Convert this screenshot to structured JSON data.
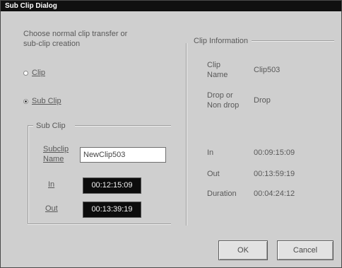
{
  "window": {
    "title": "Sub Clip Dialog"
  },
  "instructions": {
    "line1": "Choose normal clip transfer or",
    "line2": "sub-clip creation"
  },
  "mode_options": [
    {
      "label": "Clip",
      "selected": false
    },
    {
      "label": "Sub Clip",
      "selected": true
    }
  ],
  "sub_clip": {
    "group_label": "Sub Clip",
    "name_label_line1": "Subclip",
    "name_label_line2": "Name",
    "name_value": "NewClip503",
    "in_label": "In",
    "in_value": "00:12:15:09",
    "out_label": "Out",
    "out_value": "00:13:39:19"
  },
  "clip_information": {
    "group_label": "Clip Information",
    "clip_name_label_line1": "Clip",
    "clip_name_label_line2": "Name",
    "clip_name_value": "Clip503",
    "drop_label_line1": "Drop or",
    "drop_label_line2": "Non drop",
    "drop_value": "Drop",
    "in_label": "In",
    "in_value": "00:09:15:09",
    "out_label": "Out",
    "out_value": "00:13:59:19",
    "duration_label": "Duration",
    "duration_value": "00:04:24:12"
  },
  "buttons": {
    "ok_label": "OK",
    "cancel_label": "Cancel"
  }
}
